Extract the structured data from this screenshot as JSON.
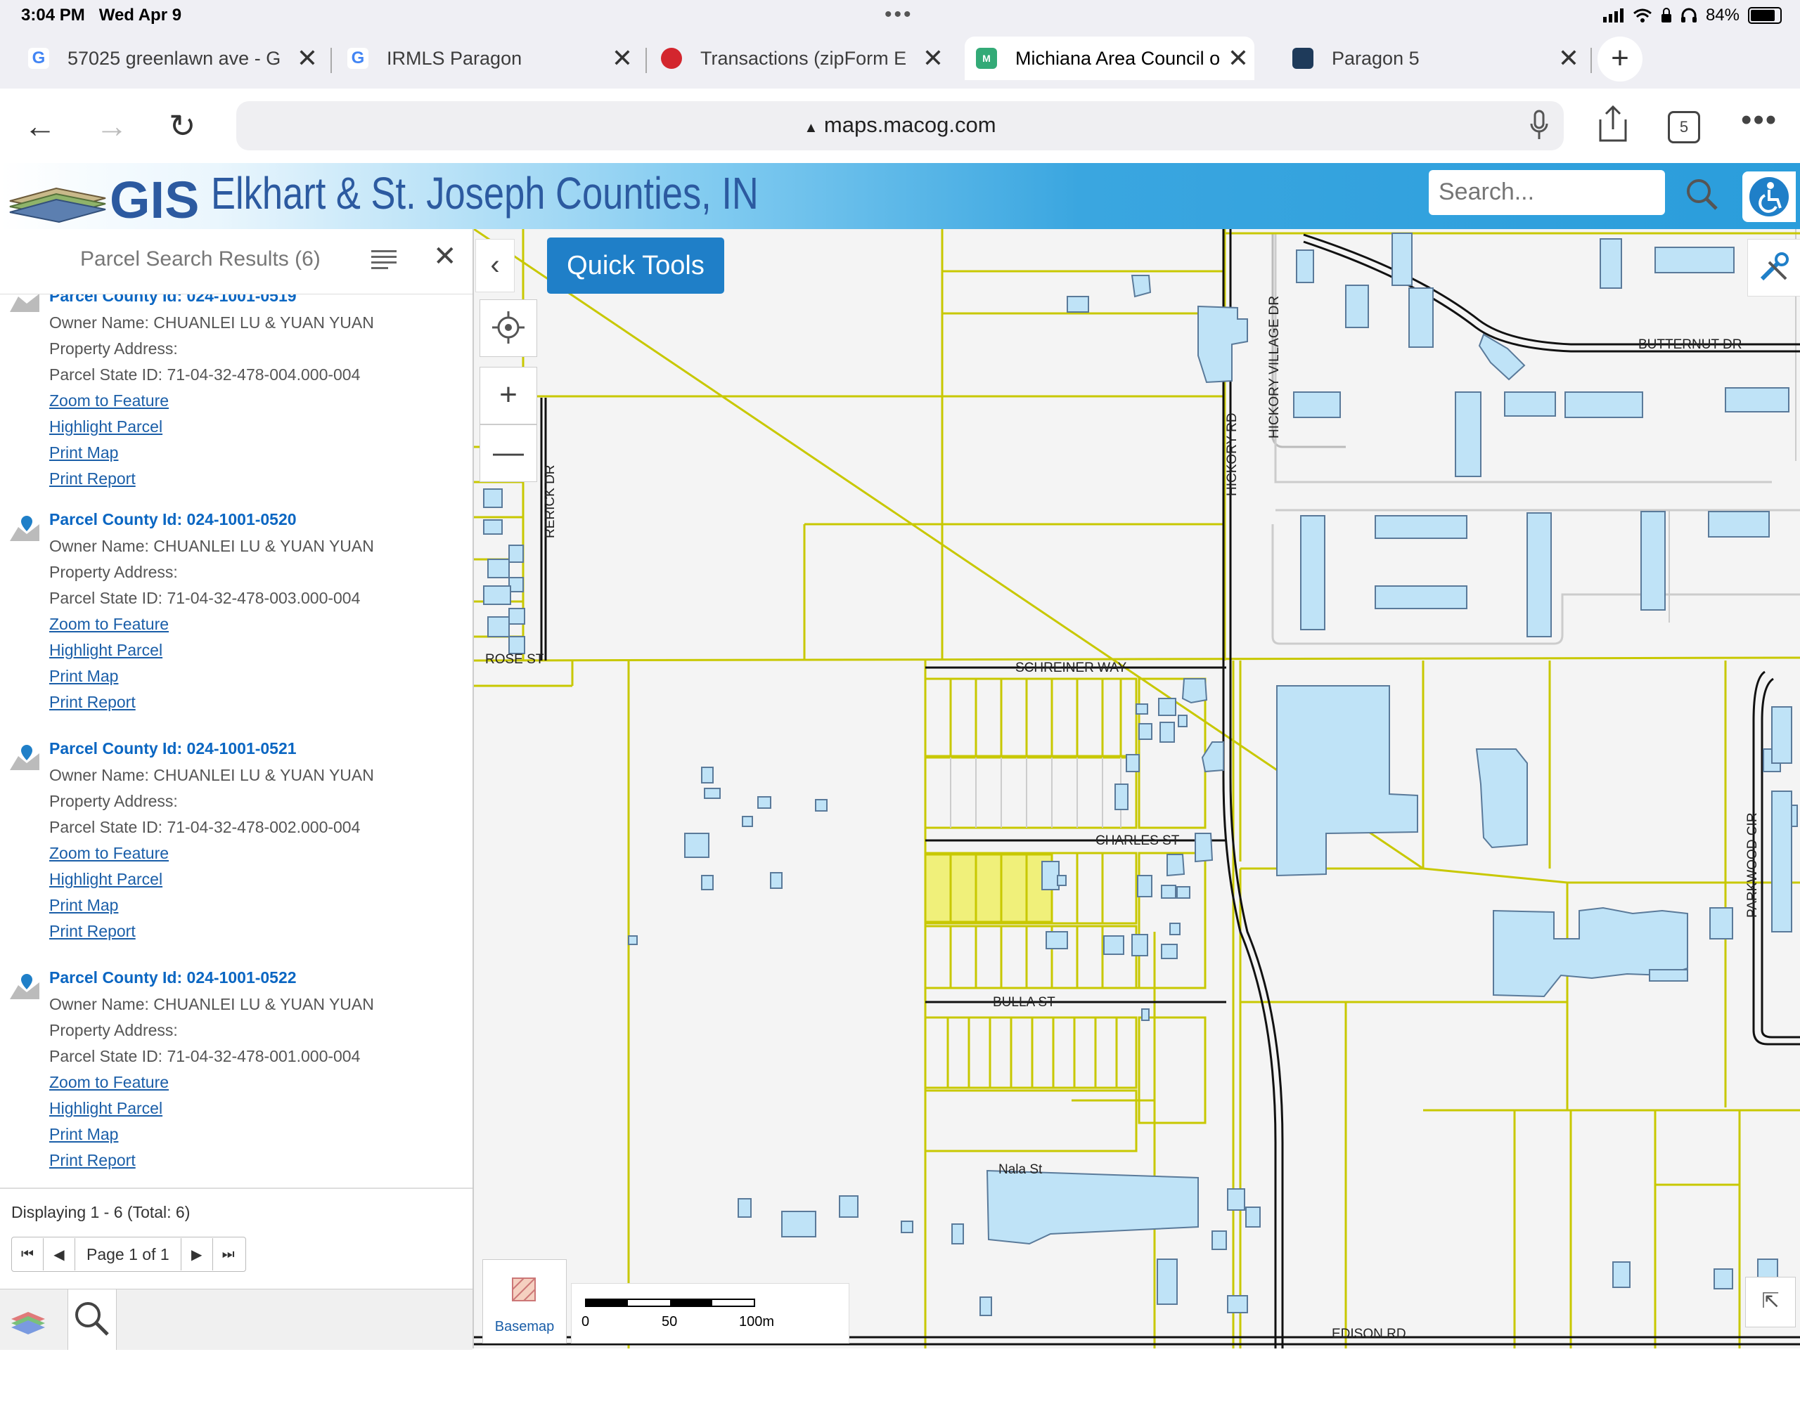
{
  "status_bar": {
    "time": "3:04 PM",
    "date": "Wed Apr 9",
    "battery": "84%"
  },
  "tabs": [
    {
      "title": "57025 greenlawn ave - G",
      "favicon": "G"
    },
    {
      "title": "IRMLS Paragon",
      "favicon": "G"
    },
    {
      "title": "Transactions (zipForm E",
      "favicon": ""
    },
    {
      "title": "Michiana Area Council o",
      "favicon": "M",
      "active": true
    },
    {
      "title": "Paragon 5",
      "favicon": ""
    }
  ],
  "browser": {
    "url": "maps.macog.com",
    "tab_count": "5"
  },
  "header": {
    "title": "Elkhart & St. Joseph Counties, IN",
    "logo_text": "GIS",
    "search_placeholder": "Search..."
  },
  "panel": {
    "title": "Parcel Search Results (6)",
    "results": [
      {
        "heading": "Parcel County Id: 024-1001-0519",
        "owner": "Owner Name: CHUANLEI LU & YUAN YUAN",
        "address": "Property Address:",
        "state_id": "Parcel State ID: 71-04-32-478-004.000-004"
      },
      {
        "heading": "Parcel County Id: 024-1001-0520",
        "owner": "Owner Name: CHUANLEI LU & YUAN YUAN",
        "address": "Property Address:",
        "state_id": "Parcel State ID: 71-04-32-478-003.000-004"
      },
      {
        "heading": "Parcel County Id: 024-1001-0521",
        "owner": "Owner Name: CHUANLEI LU & YUAN YUAN",
        "address": "Property Address:",
        "state_id": "Parcel State ID: 71-04-32-478-002.000-004"
      },
      {
        "heading": "Parcel County Id: 024-1001-0522",
        "owner": "Owner Name: CHUANLEI LU & YUAN YUAN",
        "address": "Property Address:",
        "state_id": "Parcel State ID: 71-04-32-478-001.000-004"
      }
    ],
    "links": {
      "zoom": "Zoom to Feature",
      "highlight": "Highlight Parcel",
      "print_map": "Print Map",
      "print_report": "Print Report"
    },
    "displaying": "Displaying 1 - 6 (Total: 6)",
    "pager": {
      "label": "Page 1 of 1"
    }
  },
  "map": {
    "quick_tools": "Quick Tools",
    "basemap_label": "Basemap",
    "scale": {
      "ticks": [
        "0",
        "50",
        "100m"
      ]
    },
    "streets": [
      "BUTTERNUT DR",
      "HICKORY VILLAGE DR",
      "HICKORY RD",
      "RERICK DR",
      "ROSE ST",
      "SCHREINER WAY",
      "CHARLES ST",
      "BULLA ST",
      "Nala St",
      "PARKWOOD CIR",
      "EDISON RD"
    ],
    "colors": {
      "parcel_line": "#c8c800",
      "building": "#bfe3f7",
      "highlight": "#f0f07a"
    }
  }
}
